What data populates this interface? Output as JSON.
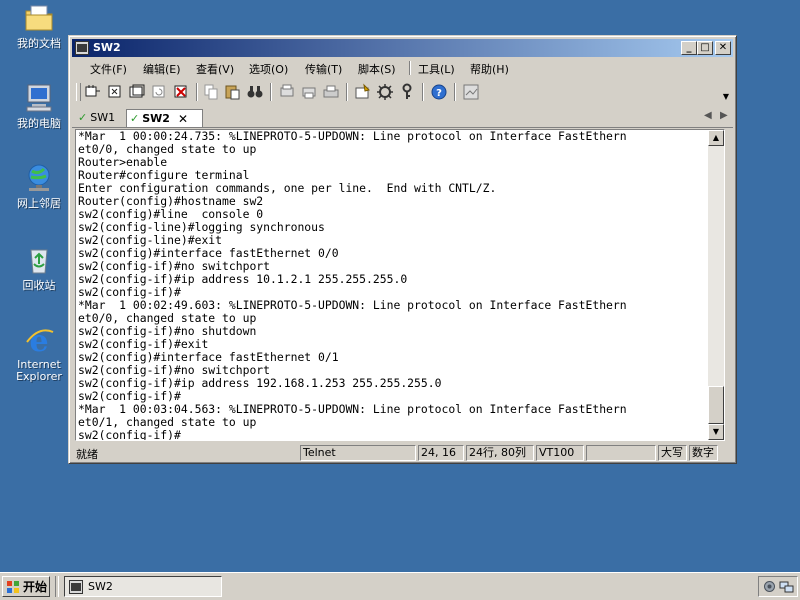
{
  "desktop": {
    "icons": [
      {
        "label": "我的文档",
        "icon": "my-documents-icon"
      },
      {
        "label": "我的电脑",
        "icon": "my-computer-icon"
      },
      {
        "label": "网上邻居",
        "icon": "network-places-icon"
      },
      {
        "label": "回收站",
        "icon": "recycle-bin-icon"
      },
      {
        "label": "Internet Explorer",
        "icon": "internet-explorer-icon"
      }
    ]
  },
  "window": {
    "title": "SW2",
    "menu": [
      "文件(F)",
      "编辑(E)",
      "查看(V)",
      "选项(O)",
      "传输(T)",
      "脚本(S)",
      "工具(L)",
      "帮助(H)"
    ],
    "tabs": [
      {
        "label": "SW1",
        "active": false
      },
      {
        "label": "SW2",
        "active": true
      }
    ],
    "terminal_lines": [
      "*Mar  1 00:00:24.735: %LINEPROTO-5-UPDOWN: Line protocol on Interface FastEthern",
      "et0/0, changed state to up",
      "Router>enable",
      "Router#configure terminal",
      "Enter configuration commands, one per line.  End with CNTL/Z.",
      "Router(config)#hostname sw2",
      "sw2(config)#line  console 0",
      "sw2(config-line)#logging synchronous",
      "sw2(config-line)#exit",
      "sw2(config)#interface fastEthernet 0/0",
      "sw2(config-if)#no switchport",
      "sw2(config-if)#ip address 10.1.2.1 255.255.255.0",
      "sw2(config-if)#",
      "*Mar  1 00:02:49.603: %LINEPROTO-5-UPDOWN: Line protocol on Interface FastEthern",
      "et0/0, changed state to up",
      "sw2(config-if)#no shutdown",
      "sw2(config-if)#exit",
      "sw2(config)#interface fastEthernet 0/1",
      "sw2(config-if)#no switchport",
      "sw2(config-if)#ip address 192.168.1.253 255.255.255.0",
      "sw2(config-if)#",
      "*Mar  1 00:03:04.563: %LINEPROTO-5-UPDOWN: Line protocol on Interface FastEthern",
      "et0/1, changed state to up",
      "sw2(config-if)#"
    ],
    "status": {
      "ready": "就绪",
      "protocol": "Telnet",
      "cursor": "24, 16",
      "size": "24行, 80列",
      "emulation": "VT100",
      "caps": "大写",
      "num": "数字"
    }
  },
  "taskbar": {
    "start_label": "开始",
    "task_label": "SW2"
  }
}
